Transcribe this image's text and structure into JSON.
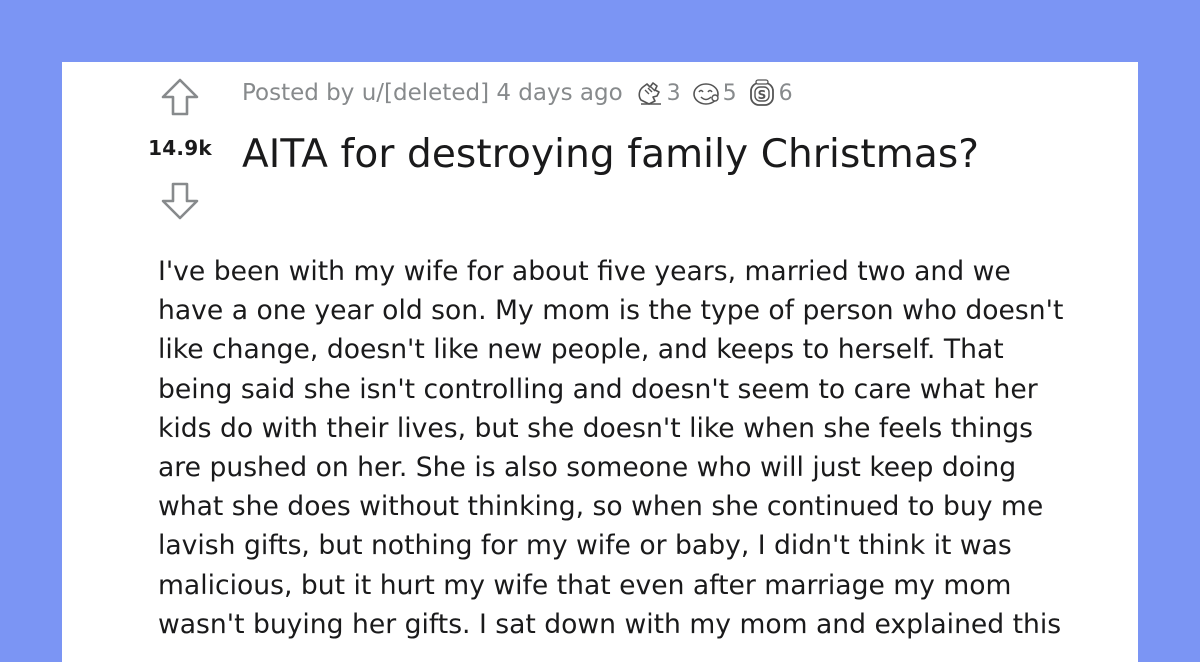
{
  "colors": {
    "page_background": "#7b95f4",
    "card_background": "#ffffff",
    "meta_text": "#878a8c",
    "text": "#1a1a1b"
  },
  "post": {
    "score": "14.9k",
    "meta": {
      "posted_by": "Posted by u/[deleted] 4 days ago"
    },
    "awards": [
      {
        "icon": "helpful-award-icon",
        "count": "3"
      },
      {
        "icon": "wholesome-award-icon",
        "count": "5"
      },
      {
        "icon": "silver-award-icon",
        "count": "6"
      }
    ],
    "title": "AITA for destroying family Christmas?",
    "body_lines": [
      "I've been with my wife for about five years, married two and we",
      "have a one year old son. My mom is the type of person who doesn't",
      "like change, doesn't like new people, and keeps to herself. That",
      "being said she isn't controlling and doesn't seem to care what her",
      "kids do with their lives, but she doesn't like when she feels things",
      "are pushed on her. She is also someone who will just keep doing",
      "what she does without thinking, so when she continued to buy me",
      "lavish gifts, but nothing for my wife or baby, I didn't think it was",
      "malicious, but it hurt my wife that even after marriage my mom",
      "wasn't buying her gifts. I sat down with my mom and explained this"
    ]
  }
}
